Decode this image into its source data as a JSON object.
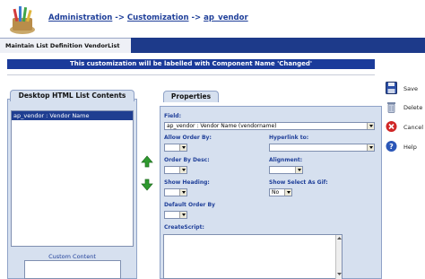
{
  "breadcrumb": {
    "items": [
      "Administration",
      "Customization",
      "ap_vendor"
    ],
    "separator": "->"
  },
  "title_tab": "Maintain List Definition VendorList",
  "notice": "This customization will be labelled with Component Name 'Changed'",
  "left_panel": {
    "tab": "Desktop HTML List Contents",
    "selected_item": "ap_vendor : Vendor Name",
    "custom_content_label": "Custom Content"
  },
  "right_panel": {
    "tab": "Properties",
    "field_label": "Field:",
    "field_value": "ap_vendor : Vendor Name (vendorname)",
    "allow_order_by": "Allow Order By:",
    "hyperlink_to": "Hyperlink to:",
    "order_by_desc": "Order By Desc:",
    "alignment": "Alignment:",
    "show_heading": "Show Heading:",
    "show_select_as_gif": "Show Select As Gif:",
    "show_select_as_gif_value": "No",
    "default_order_by": "Default Order By",
    "create_script": "CreateScript:"
  },
  "actions": {
    "save": "Save",
    "delete": "Delete",
    "cancel": "Cancel",
    "help": "Help"
  },
  "colors": {
    "title_bar": "#1d3a8a",
    "link": "#1f3f99",
    "panel": "#d6e0ef",
    "selected": "#1f3e91",
    "arrows": "#2f9a2f"
  }
}
